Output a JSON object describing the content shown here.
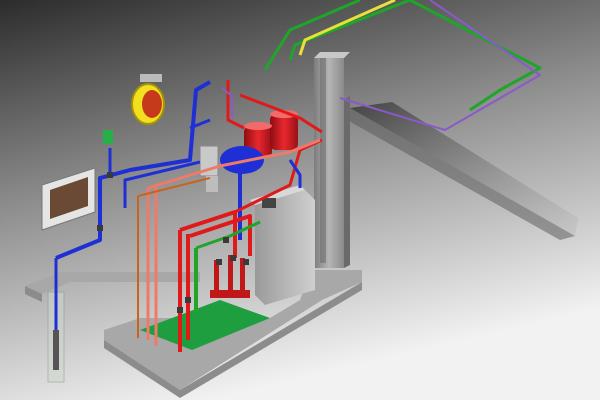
{
  "scene": {
    "background_top": "#2c2c2c",
    "background_bottom": "#f2f2f2"
  },
  "colors": {
    "cold_water": "#1e2fd6",
    "hot_water": "#e01a1a",
    "return_line": "#ef7a6a",
    "supply_green": "#1fa52a",
    "exhaust_yellow": "#e6e23a",
    "drain_orange": "#c8641e",
    "pad_green": "#1f9e40",
    "concrete": "#a8a8a8",
    "tank_red": "#d4141e",
    "accent_purple": "#8a5ac8"
  },
  "components": {
    "well_pump": "well-casing",
    "pressure_tank": "radiator-heat-exchanger",
    "hose_reel": "yellow-reel",
    "expansion_tank": "green-expansion-tank",
    "buffer_tanks": "red-pressure-tanks",
    "boiler": "boiler-unit",
    "chimney": "exhaust-stack",
    "manifold": "distribution-manifold",
    "solar_collector": "roof-collector-panel"
  }
}
